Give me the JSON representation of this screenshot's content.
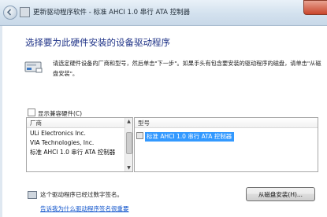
{
  "window": {
    "title": "更新驱动程序软件 - 标准 AHCI 1.0 串行 ATA 控制器"
  },
  "heading": "选择要为此硬件安装的设备驱动程序",
  "description": "请选定硬件设备的厂商和型号，然后单击\"下一步\"。如果手头有包含要安装的驱动程序的磁盘，请单击\"从磁盘安装\"。",
  "compat_checkbox": {
    "label": "显示兼容硬件(C)",
    "checked": false
  },
  "manufacturer": {
    "header": "厂商",
    "items": [
      "ULi Electronics Inc.",
      "VIA Technologies, Inc.",
      "标准 AHCI 1.0 串行 ATA 控制器"
    ]
  },
  "model": {
    "header": "型号",
    "items": [
      "标准 AHCI 1.0 串行 ATA 控制器"
    ]
  },
  "signature": {
    "text": "这个驱动程序已经过数字签名。",
    "link": "告诉我为什么驱动程序签名很重要"
  },
  "buttons": {
    "have_disk": "从磁盘安装(H)..."
  }
}
